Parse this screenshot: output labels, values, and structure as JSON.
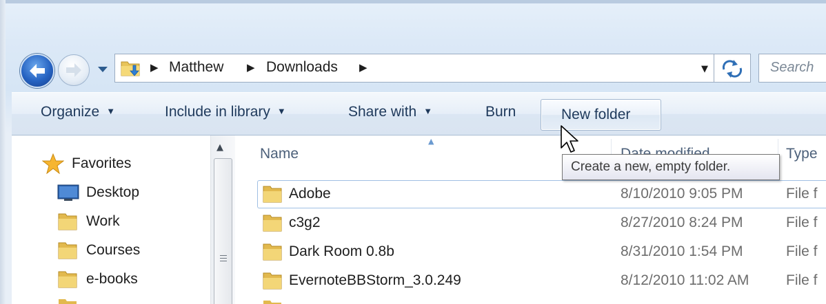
{
  "window": {
    "chrome_color": "#dce9f7",
    "accent": "#1e395b"
  },
  "nav": {
    "back_icon": "back-arrow-icon",
    "forward_icon": "forward-arrow-icon",
    "history_icon": "chevron-down-icon"
  },
  "address_bar": {
    "icon": "downloads-folder-icon",
    "breadcrumbs": [
      "Matthew",
      "Downloads"
    ],
    "dropdown_icon": "chevron-down-icon",
    "refresh_icon": "refresh-icon"
  },
  "search": {
    "placeholder": "Search"
  },
  "toolbar": {
    "organize": "Organize",
    "include_in_library": "Include in library",
    "share_with": "Share with",
    "burn": "Burn",
    "new_folder": "New folder"
  },
  "tooltip": {
    "text": "Create a new, empty folder."
  },
  "navigation_pane": {
    "favorites": "Favorites",
    "items": [
      {
        "label": "Desktop",
        "icon": "desktop-icon"
      },
      {
        "label": "Work",
        "icon": "folder-icon"
      },
      {
        "label": "Courses",
        "icon": "folder-icon"
      },
      {
        "label": "e-books",
        "icon": "folder-icon"
      }
    ]
  },
  "file_list": {
    "columns": {
      "name": "Name",
      "date_modified": "Date modified",
      "type": "Type"
    },
    "rows": [
      {
        "name": "Adobe",
        "date": "8/10/2010 9:05 PM",
        "type": "File f"
      },
      {
        "name": "c3g2",
        "date": "8/27/2010 8:24 PM",
        "type": "File f"
      },
      {
        "name": "Dark Room 0.8b",
        "date": "8/31/2010 1:54 PM",
        "type": "File f"
      },
      {
        "name": "EvernoteBBStorm_3.0.249",
        "date": "8/12/2010 11:02 AM",
        "type": "File f"
      }
    ]
  }
}
